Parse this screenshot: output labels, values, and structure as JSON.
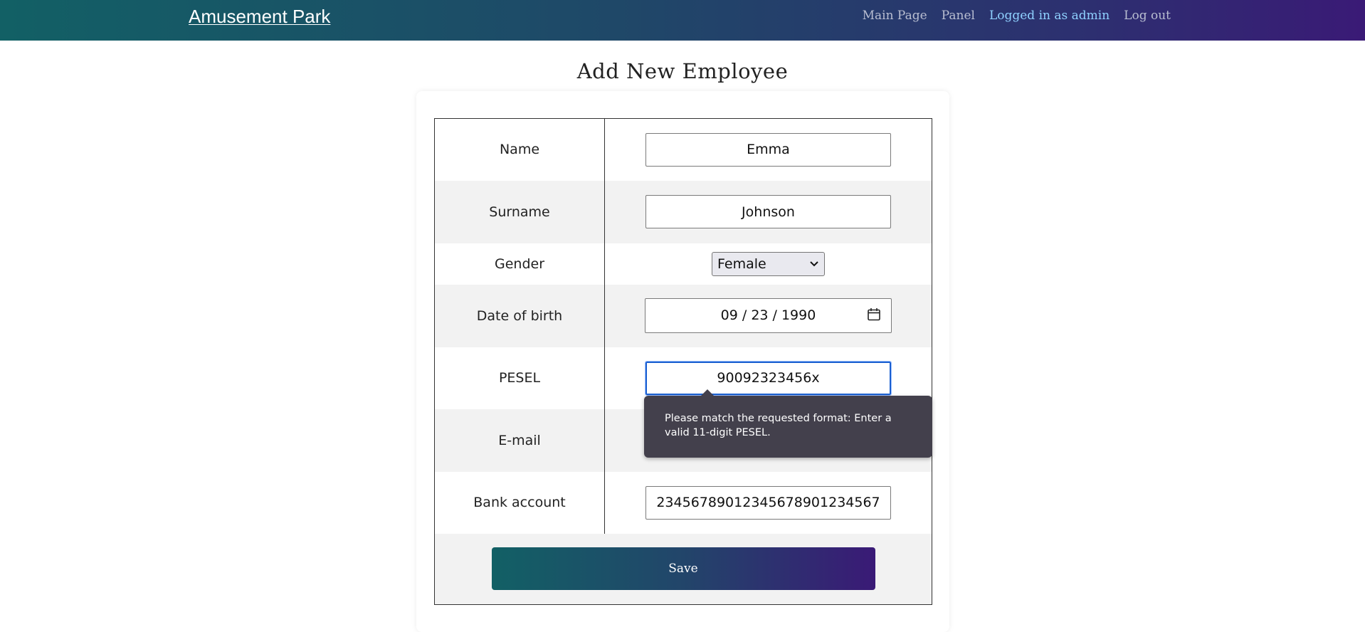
{
  "navbar": {
    "brand": "Amusement Park",
    "links": [
      {
        "label": "Main Page",
        "active": false
      },
      {
        "label": "Panel",
        "active": false
      },
      {
        "label": "Logged in as admin",
        "active": true
      },
      {
        "label": "Log out",
        "active": false
      }
    ]
  },
  "page": {
    "title": "Add New Employee"
  },
  "form": {
    "name": {
      "label": "Name",
      "value": "Emma"
    },
    "surname": {
      "label": "Surname",
      "value": "Johnson"
    },
    "gender": {
      "label": "Gender",
      "selected": "Female"
    },
    "dob": {
      "label": "Date of birth",
      "value": "09 / 23 / 1990"
    },
    "pesel": {
      "label": "PESEL",
      "value": "90092323456x"
    },
    "email": {
      "label": "E-mail",
      "value": ""
    },
    "bank": {
      "label": "Bank account",
      "value": "23456789012345678901234567"
    },
    "save_label": "Save"
  },
  "tooltip": {
    "text": "Please match the requested format: Enter a valid 11-digit PESEL."
  },
  "colors": {
    "accent_teal": "#126065",
    "accent_purple": "#3a1a76",
    "active_link": "#8fd1ff",
    "focus_border": "#1a5fd0"
  }
}
